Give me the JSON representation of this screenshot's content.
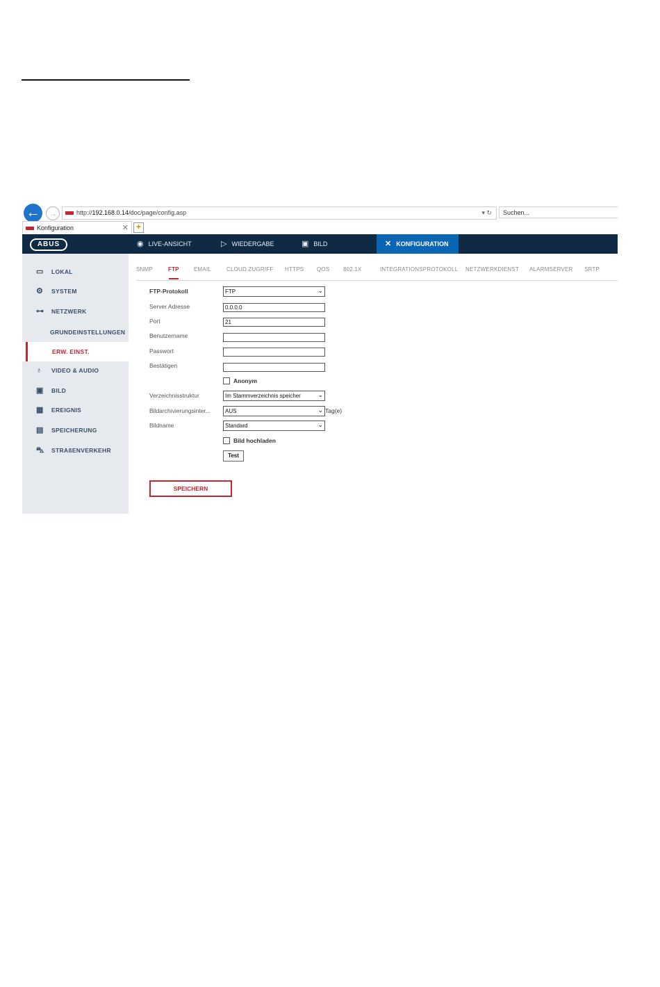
{
  "browser": {
    "url_prefix": "http://",
    "url_host": "192.168.0.14",
    "url_path": "/doc/page/config.asp",
    "url_controls": "▾ ↻",
    "search_placeholder": "Suchen...",
    "tab_title": "Konfiguration",
    "tab_close": "✕"
  },
  "app": {
    "logo": "ABUS",
    "nav": [
      {
        "label": "LIVE-ANSICHT"
      },
      {
        "label": "WIEDERGABE"
      },
      {
        "label": "BILD"
      },
      {
        "label": "KONFIGURATION",
        "active": true
      }
    ]
  },
  "sidebar": {
    "items": [
      {
        "label": "LOKAL"
      },
      {
        "label": "SYSTEM"
      },
      {
        "label": "NETZWERK"
      },
      {
        "label": "GRUNDEINSTELLUNGEN"
      },
      {
        "label": "ERW. EINST.",
        "active": true
      },
      {
        "label": "VIDEO & AUDIO"
      },
      {
        "label": "BILD"
      },
      {
        "label": "EREIGNIS"
      },
      {
        "label": "SPEICHERUNG"
      },
      {
        "label": "STRAßENVERKEHR"
      }
    ]
  },
  "tabs": [
    {
      "label": "SNMP"
    },
    {
      "label": "FTP",
      "active": true
    },
    {
      "label": "EMAIL"
    },
    {
      "label": "CLOUD ZUGRIFF"
    },
    {
      "label": "HTTPS"
    },
    {
      "label": "QOS"
    },
    {
      "label": "802.1X"
    },
    {
      "label": "INTEGRATIONSPROTOKOLL"
    },
    {
      "label": "NETZWERKDIENST"
    },
    {
      "label": "ALARMSERVER"
    },
    {
      "label": "SRTP"
    }
  ],
  "form": {
    "ftp_protocol": {
      "label": "FTP-Protokoll",
      "value": "FTP"
    },
    "server_address": {
      "label": "Server Adresse",
      "value": "0.0.0.0"
    },
    "port": {
      "label": "Port",
      "value": "21"
    },
    "username": {
      "label": "Benutzername",
      "value": ""
    },
    "password": {
      "label": "Passwort",
      "value": ""
    },
    "confirm": {
      "label": "Bestätigen",
      "value": ""
    },
    "anonymous": {
      "label": "Anonym",
      "checked": false
    },
    "directory": {
      "label": "Verzeichnisstruktur",
      "value": "Im Stammverzeichnis speicher"
    },
    "archive_interval": {
      "label": "Bildarchivierungsinter...",
      "value": "AUS",
      "suffix": "Tag(e)"
    },
    "image_name": {
      "label": "Bildname",
      "value": "Standard"
    },
    "upload_image": {
      "label": "Bild hochladen",
      "checked": false
    },
    "test_label": "Test",
    "save_label": "SPEICHERN"
  },
  "colors": {
    "accent": "#c8242f",
    "navbar": "#0f2a44",
    "nav_active": "#0b65b5",
    "sidebar": "#e6e9ed"
  }
}
